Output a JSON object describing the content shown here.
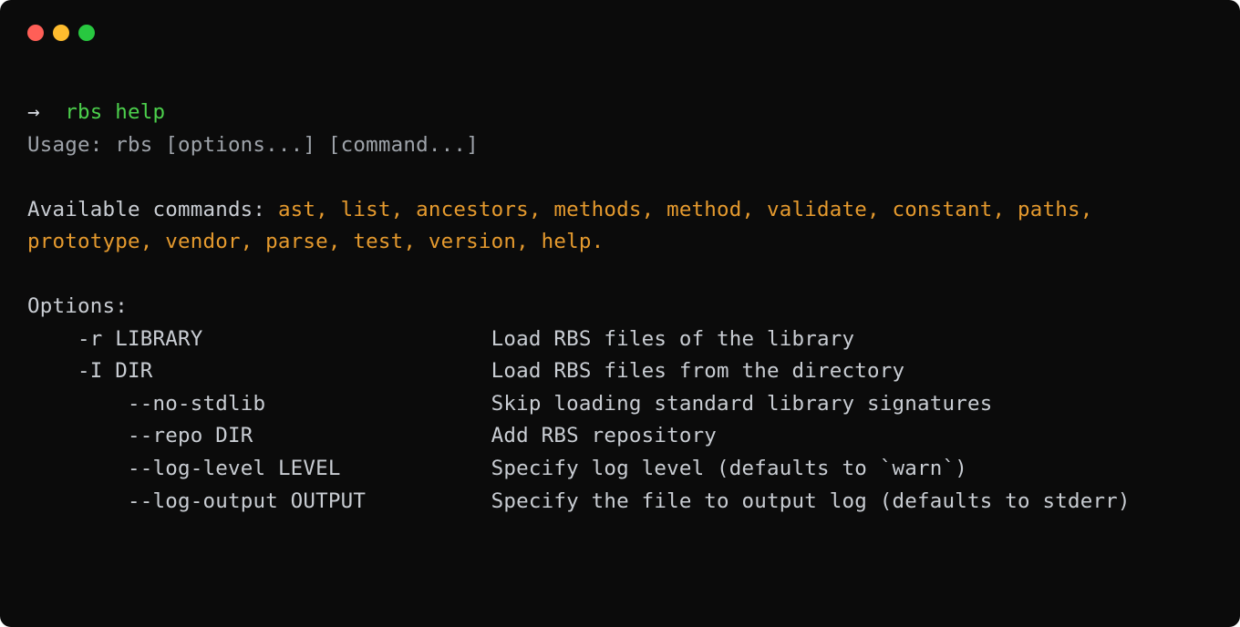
{
  "traffic_lights": {
    "close_color": "#ff5f57",
    "min_color": "#febc2e",
    "max_color": "#28c840"
  },
  "prompt": {
    "arrow": "→  ",
    "command": "rbs help"
  },
  "usage_line": "Usage: rbs [options...] [command...]",
  "available_label": "Available commands: ",
  "available_commands": "ast, list, ancestors, methods, method, validate, constant, paths, prototype, vendor, parse, test, version, help.",
  "options_header": "Options:",
  "options": [
    {
      "flag": "    -r LIBRARY                       ",
      "desc": "Load RBS files of the library"
    },
    {
      "flag": "    -I DIR                           ",
      "desc": "Load RBS files from the directory"
    },
    {
      "flag": "        --no-stdlib                  ",
      "desc": "Skip loading standard library signatures"
    },
    {
      "flag": "        --repo DIR                   ",
      "desc": "Add RBS repository"
    },
    {
      "flag": "        --log-level LEVEL            ",
      "desc": "Specify log level (defaults to `warn`)"
    },
    {
      "flag": "        --log-output OUTPUT          ",
      "desc": "Specify the file to output log (defaults to stderr)"
    }
  ]
}
